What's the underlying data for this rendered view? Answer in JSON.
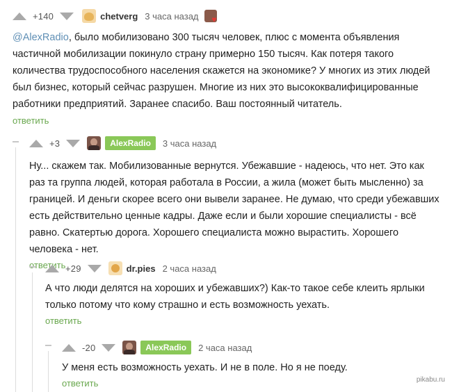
{
  "comments": [
    {
      "rating": "+140",
      "username": "chetverg",
      "time": "3 часа назад",
      "mention": "@AlexRadio",
      "text": ", было мобилизовано 300 тысяч человек, плюс с момента объявления частичной мобилизации покинуло страну примерно 150 тысяч. Как потеря такого количества трудоспособного населения скажется на экономике? У многих из этих людей был бизнес, который сейчас разрушен. Многие из них это высококвалифицированные работники предприятий. Заранее спасибо. Ваш постоянный читатель.",
      "reply": "ответить"
    },
    {
      "rating": "+3",
      "username": "AlexRadio",
      "time": "3 часа назад",
      "text": "Ну... скажем так. Мобилизованные вернутся. Убежавшие - надеюсь, что нет. Это как раз та группа людей, которая работала в России, а жила (может быть мысленно) за границей. И деньги скорее всего они вывели заранее. Не думаю, что среди убежавших есть действительно ценные кадры. Даже если и были хорошие специалисты - всё равно. Скатертью дорога. Хорошего специалиста можно вырастить. Хорошего человека - нет.",
      "reply": "ответить"
    },
    {
      "rating": "+29",
      "username": "dr.pies",
      "time": "2 часа назад",
      "text": "А что люди делятся на хороших и убежавших?) Как-то такое себе клеить ярлыки только потому что кому страшно и есть возможность уехать.",
      "reply": "ответить"
    },
    {
      "rating": "-20",
      "username": "AlexRadio",
      "time": "2 часа назад",
      "text": "У меня есть возможность уехать. И не в поле. Но я не поеду.",
      "reply": "ответить"
    }
  ],
  "watermark": "pikabu.ru"
}
